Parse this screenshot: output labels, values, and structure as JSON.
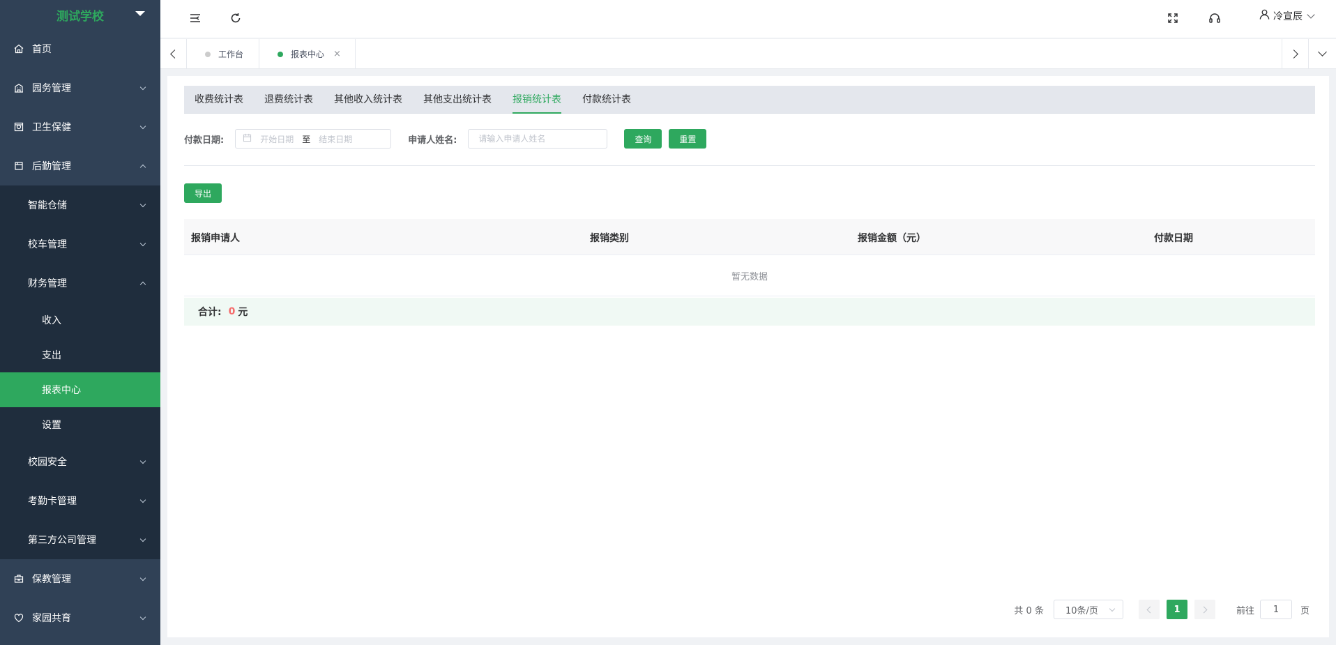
{
  "sidebar": {
    "title": "测试学校",
    "menu": [
      {
        "label": "首页",
        "icon": "home-icon"
      },
      {
        "label": "园务管理",
        "icon": "building-icon"
      },
      {
        "label": "卫生保健",
        "icon": "health-icon"
      },
      {
        "label": "后勤管理",
        "icon": "logistics-icon"
      }
    ],
    "logistics_sub": {
      "storage": "智能仓储",
      "bus": "校车管理",
      "finance": "财务管理",
      "finance_items": [
        "收入",
        "支出",
        "报表中心",
        "设置"
      ],
      "safety": "校园安全",
      "attendance": "考勤卡管理",
      "third_party": "第三方公司管理"
    },
    "menu_bottom": [
      {
        "label": "保教管理",
        "icon": "briefcase-icon"
      },
      {
        "label": "家园共育",
        "icon": "heart-icon"
      }
    ]
  },
  "navbar": {
    "user_name": "冷宣辰"
  },
  "tags": {
    "items": [
      {
        "label": "工作台"
      },
      {
        "label": "报表中心",
        "close": "×"
      }
    ]
  },
  "report_tabs": [
    "收费统计表",
    "退费统计表",
    "其他收入统计表",
    "其他支出统计表",
    "报销统计表",
    "付款统计表"
  ],
  "filters": {
    "date_label": "付款日期:",
    "start_placeholder": "开始日期",
    "date_separator": "至",
    "end_placeholder": "结束日期",
    "name_label": "申请人姓名:",
    "name_placeholder": "请输入申请人姓名",
    "query_label": "查询",
    "reset_label": "重置"
  },
  "export_label": "导出",
  "table": {
    "columns": [
      "报销申请人",
      "报销类别",
      "报销金额（元）",
      "付款日期"
    ],
    "empty_text": "暂无数据"
  },
  "summary": {
    "label": "合计:",
    "value": "0",
    "unit": "元"
  },
  "pagination": {
    "total_text": "共 0 条",
    "page_size": "10条/页",
    "current_page": "1",
    "goto_label": "前往",
    "goto_value": "1",
    "page_suffix": "页"
  },
  "colors": {
    "primary": "#2ea85e",
    "sidebar_bg": "#304156",
    "submenu_bg": "#1f2d3d",
    "summary_value": "#f56c6c"
  }
}
